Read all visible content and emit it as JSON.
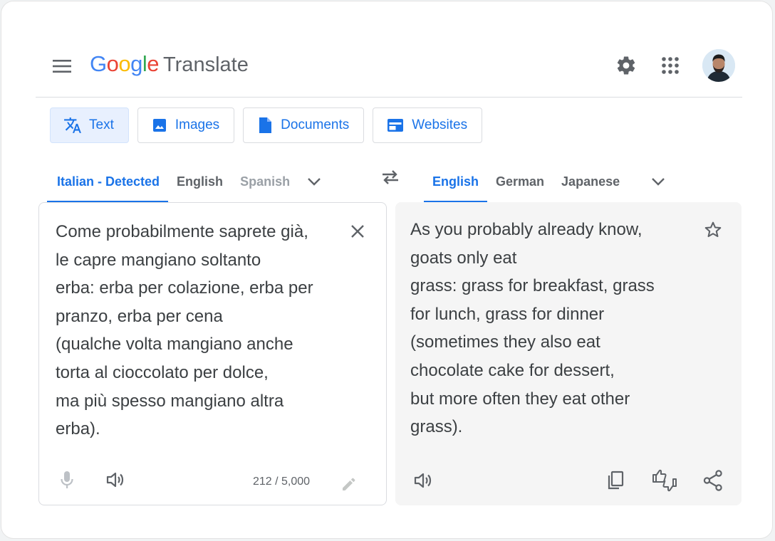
{
  "header": {
    "logo_google": [
      "G",
      "o",
      "o",
      "g",
      "l",
      "e"
    ],
    "logo_colors": [
      "#4285F4",
      "#EA4335",
      "#FBBC05",
      "#4285F4",
      "#34A853",
      "#EA4335"
    ],
    "product_name": "Translate"
  },
  "mode_tabs": [
    {
      "label": "Text",
      "icon": "translate-icon",
      "active": true
    },
    {
      "label": "Images",
      "icon": "image-icon"
    },
    {
      "label": "Documents",
      "icon": "document-icon"
    },
    {
      "label": "Websites",
      "icon": "website-icon"
    }
  ],
  "source_languages": [
    "Italian - Detected",
    "English",
    "Spanish"
  ],
  "target_languages": [
    "English",
    "German",
    "Japanese"
  ],
  "source": {
    "text": "Come probabilmente saprete già,\nle capre mangiano soltanto\nerba: erba per colazione, erba per\npranzo, erba per cena\n(qualche volta mangiano anche\ntorta al cioccolato per dolce,\nma più spesso mangiano altra\nerba).",
    "char_count": "212 / 5,000"
  },
  "target": {
    "text": "As you probably already know,\ngoats only eat\ngrass: grass for breakfast, grass\nfor lunch, grass for dinner\n(sometimes they also eat\nchocolate cake for dessert,\nbut more often they eat other\ngrass)."
  },
  "colors": {
    "accent": "#1a73e8",
    "active_tab_bg": "#e8f0fe",
    "target_bg": "#f5f5f5"
  }
}
